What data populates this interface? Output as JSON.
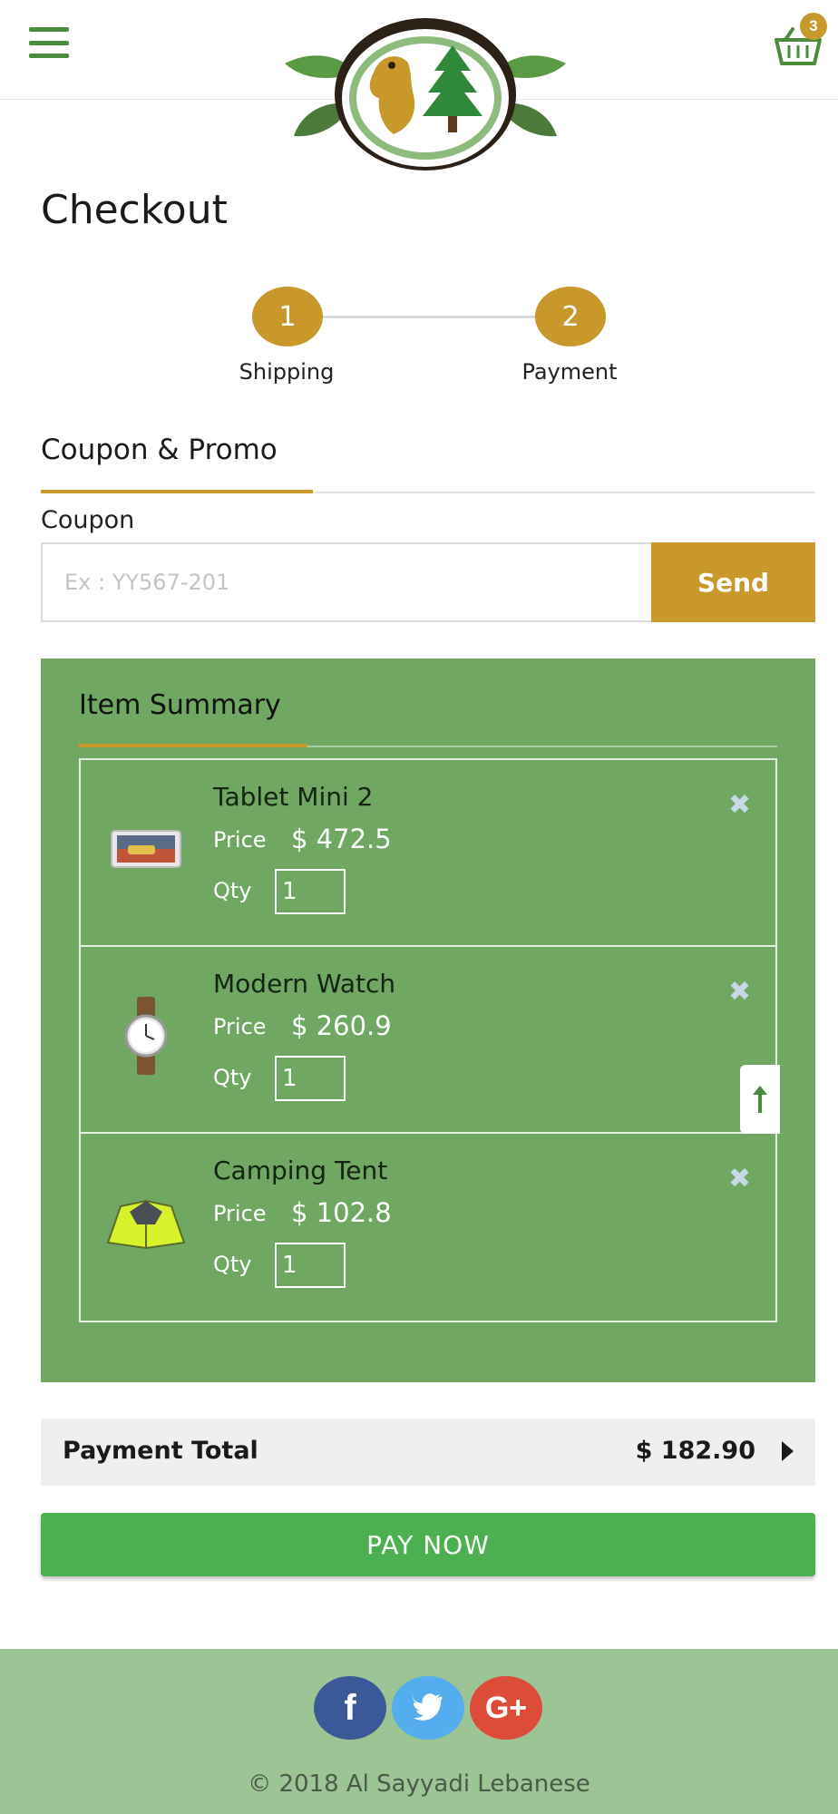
{
  "header": {
    "cart_count": "3"
  },
  "page": {
    "title": "Checkout"
  },
  "stepper": {
    "steps": [
      {
        "number": "1",
        "label": "Shipping"
      },
      {
        "number": "2",
        "label": "Payment"
      }
    ]
  },
  "coupon_section": {
    "title": "Coupon & Promo",
    "label": "Coupon",
    "placeholder": "Ex : YY567-201",
    "value": "",
    "send_label": "Send"
  },
  "item_summary": {
    "title": "Item Summary",
    "price_label": "Price",
    "qty_label": "Qty",
    "items": [
      {
        "name": "Tablet Mini 2",
        "price": "$ 472.5",
        "qty": "1",
        "icon": "tablet-image"
      },
      {
        "name": "Modern Watch",
        "price": "$ 260.9",
        "qty": "1",
        "icon": "watch-image"
      },
      {
        "name": "Camping Tent",
        "price": "$ 102.8",
        "qty": "1",
        "icon": "tent-image"
      }
    ]
  },
  "totals": {
    "label": "Payment Total",
    "value": "$ 182.90"
  },
  "pay_button_label": "PAY NOW",
  "footer": {
    "social": [
      {
        "name": "facebook",
        "glyph": "f"
      },
      {
        "name": "twitter",
        "glyph": ""
      },
      {
        "name": "google-plus",
        "glyph": "G+"
      }
    ],
    "copyright": "© 2018 Al Sayyadi Lebanese"
  },
  "colors": {
    "brand_green": "#4c8a3c",
    "gold": "#c8992a",
    "summary_bg": "#6fa763",
    "pay_green": "#4caf50",
    "footer_bg": "#9dc494"
  }
}
